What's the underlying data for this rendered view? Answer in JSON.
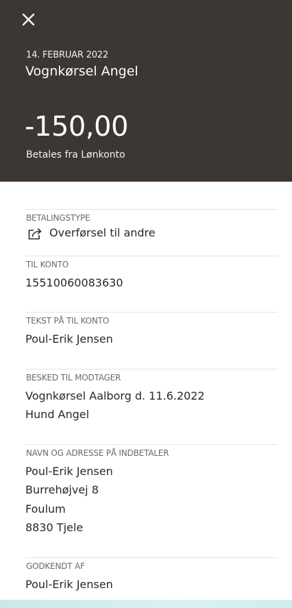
{
  "header": {
    "date": "14. FEBRUAR 2022",
    "title": "Vognkørsel Angel",
    "amount": "-150,00",
    "subtitle": "Betales fra Lønkonto"
  },
  "details": {
    "payment_type": {
      "label": "BETALINGSTYPE",
      "value": "Overførsel til andre",
      "icon": "transfer-icon"
    },
    "to_account": {
      "label": "TIL KONTO",
      "value": "15510060083630"
    },
    "text_on_account": {
      "label": "TEKST PÅ TIL KONTO",
      "value": "Poul-Erik Jensen"
    },
    "message": {
      "label": "BESKED TIL MODTAGER",
      "lines": [
        "Vognkørsel Aalborg d. 11.6.2022",
        "Hund Angel"
      ]
    },
    "payer": {
      "label": "NAVN OG ADRESSE PÅ INDBETALER",
      "lines": [
        "Poul-Erik Jensen",
        "Burrehøjvej 8",
        "Foulum",
        "8830 Tjele"
      ]
    },
    "approved_by": {
      "label": "GODKENDT AF",
      "value": "Poul-Erik Jensen"
    }
  },
  "colors": {
    "header_bg": "#3c3733",
    "divider": "#e7e3de",
    "label": "#6d6863"
  }
}
